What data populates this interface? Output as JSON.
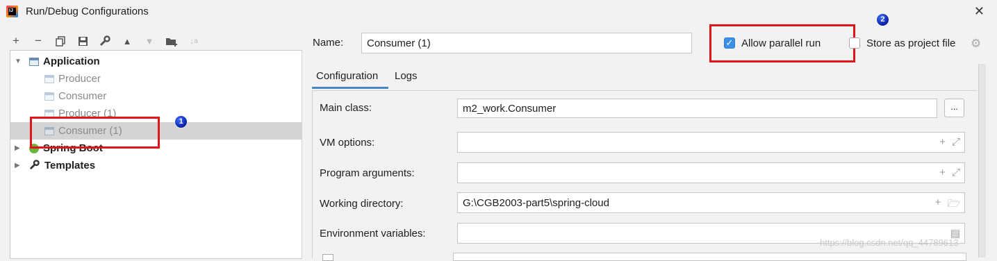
{
  "window": {
    "title": "Run/Debug Configurations",
    "close_symbol": "✕"
  },
  "toolbar": {
    "icons": [
      {
        "name": "add-icon",
        "glyph": "+",
        "enabled": true
      },
      {
        "name": "remove-icon",
        "glyph": "−",
        "enabled": true
      },
      {
        "name": "copy-icon",
        "glyph": "⧉",
        "enabled": true
      },
      {
        "name": "save-icon",
        "glyph": "🖫",
        "enabled": true
      },
      {
        "name": "wrench-icon",
        "glyph": "🔧",
        "enabled": true
      },
      {
        "name": "move-up-icon",
        "glyph": "▲",
        "enabled": true
      },
      {
        "name": "move-down-icon",
        "glyph": "▼",
        "enabled": false
      },
      {
        "name": "folder-add-icon",
        "glyph": "📁",
        "enabled": true
      },
      {
        "name": "sort-icon",
        "glyph": "↓a",
        "enabled": false
      }
    ]
  },
  "tree": {
    "application": "Application",
    "items": [
      "Producer",
      "Consumer",
      "Producer (1)",
      "Consumer (1)"
    ],
    "selected_index": 3,
    "spring_boot": "Spring Boot",
    "templates": "Templates"
  },
  "form": {
    "name_label": "Name:",
    "name_value": "Consumer (1)",
    "allow_parallel_label": "Allow parallel run",
    "allow_parallel_checked": true,
    "store_label": "Store as project file",
    "store_checked": false
  },
  "tabs": {
    "configuration": "Configuration",
    "logs": "Logs",
    "active": "configuration"
  },
  "config": {
    "main_class_label": "Main class:",
    "main_class_value": "m2_work.Consumer",
    "browse_label": "...",
    "vm_label": "VM options:",
    "vm_value": "",
    "args_label": "Program arguments:",
    "args_value": "",
    "workdir_label": "Working directory:",
    "workdir_value": "G:\\CGB2003-part5\\spring-cloud",
    "env_label": "Environment variables:",
    "env_value": ""
  },
  "annotations": {
    "badge1": "1",
    "badge2": "2",
    "highlight_color": "#e1141a"
  },
  "watermark": "https://blog.csdn.net/qq_44789613",
  "colors": {
    "accent": "#3d8ee8",
    "tab_underline": "#4a88c7",
    "selection": "#d4d4d4"
  }
}
